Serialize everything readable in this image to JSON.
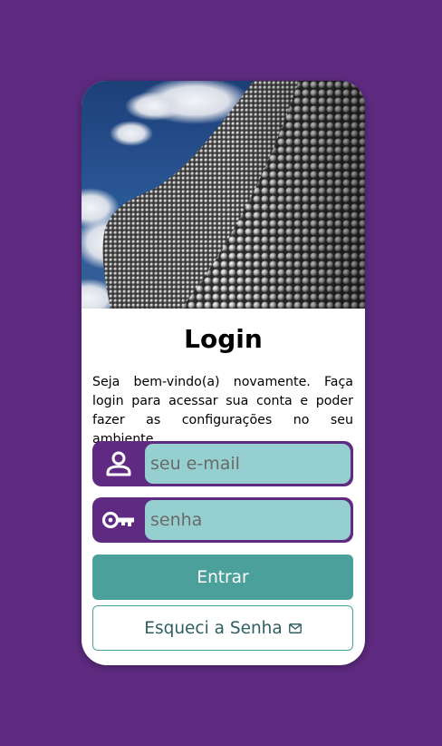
{
  "hero": {
    "alt": "Fachada de edifício coberta de discos metálicos contra um céu azul"
  },
  "login": {
    "title": "Login",
    "description": "Seja bem-vindo(a) novamente. Faça login para acessar sua conta e poder fazer as configurações no seu ambiente.",
    "email_placeholder": "seu e-mail",
    "email_value": "",
    "email_icon": "user-icon",
    "password_placeholder": "senha",
    "password_value": "",
    "password_icon": "key-icon",
    "submit_label": "Entrar",
    "forgot_label": "Esqueci a Senha",
    "forgot_icon": "envelope-icon"
  },
  "colors": {
    "background": "#5f2b82",
    "card": "#ffffff",
    "input_fill": "#95cfcf",
    "primary_button": "#4ba09c",
    "secondary_text": "#2f5f60"
  }
}
